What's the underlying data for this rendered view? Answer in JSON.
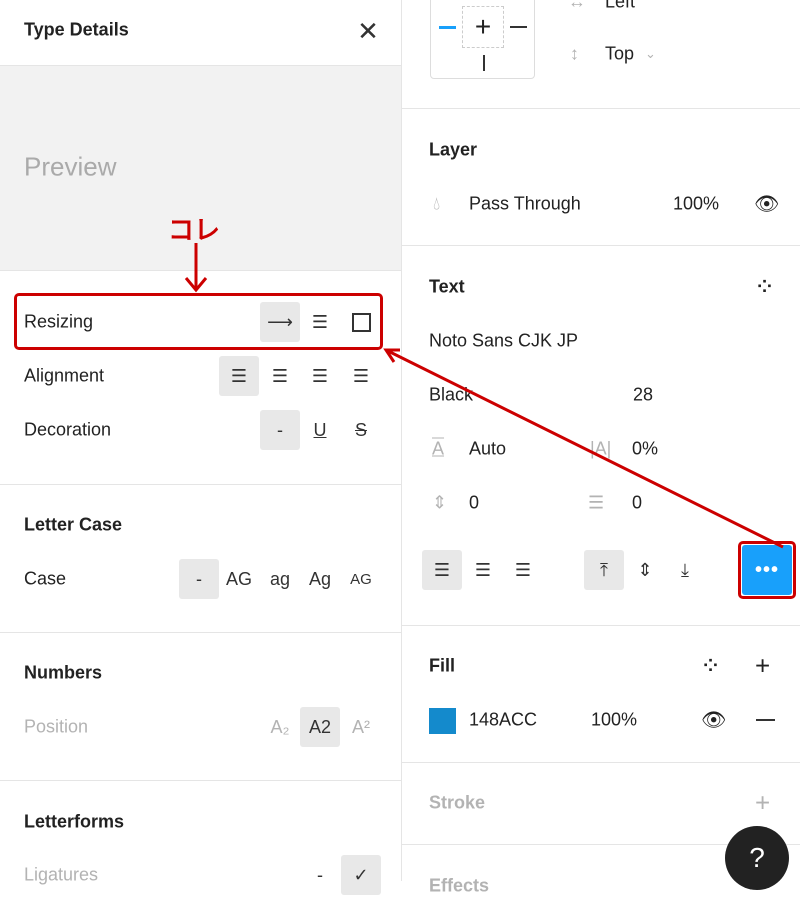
{
  "left": {
    "title": "Type Details",
    "preview": "Preview",
    "resizing": "Resizing",
    "alignment": "Alignment",
    "decoration": "Decoration",
    "decoration_none": "-",
    "letter_case_title": "Letter Case",
    "case": "Case",
    "case_options": [
      "-",
      "AG",
      "ag",
      "Ag",
      "AG"
    ],
    "numbers_title": "Numbers",
    "position": "Position",
    "position_options": [
      "A₂",
      "A2",
      "A²"
    ],
    "letterforms_title": "Letterforms",
    "ligatures": "Ligatures",
    "ligatures_none": "-"
  },
  "right": {
    "constraint_h": "Left",
    "constraint_v": "Top",
    "layer_title": "Layer",
    "blend": "Pass Through",
    "opacity": "100%",
    "text_title": "Text",
    "font": "Noto Sans CJK JP",
    "weight": "Black",
    "size": "28",
    "line_height": "Auto",
    "letter_spacing": "0%",
    "paragraph_spacing": "0",
    "paragraph_indent": "0",
    "fill_title": "Fill",
    "fill_color": "148ACC",
    "fill_opacity": "100%",
    "stroke_title": "Stroke",
    "effects_title": "Effects",
    "help": "?"
  },
  "annotation": {
    "label": "コレ",
    "color": "#cc0000"
  },
  "colors": {
    "accent": "#18A0FB",
    "fill": "#148ACC"
  }
}
